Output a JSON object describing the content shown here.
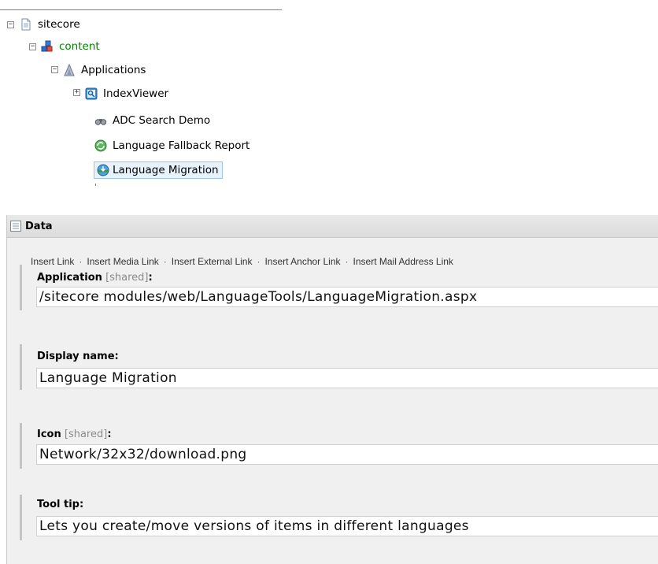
{
  "tree": {
    "root": {
      "label": "sitecore",
      "toggle": "−"
    },
    "content": {
      "label": "content",
      "toggle": "−"
    },
    "applications": {
      "label": "Applications",
      "toggle": "−"
    },
    "indexviewer": {
      "label": "IndexViewer",
      "toggle": "+"
    },
    "adc_search_demo": {
      "label": "ADC Search Demo"
    },
    "language_fallback_report": {
      "label": "Language Fallback Report"
    },
    "language_migration": {
      "label": "Language Migration",
      "selected": true
    }
  },
  "data_section": {
    "title": "Data",
    "toolbar": {
      "insert_link": "Insert Link",
      "insert_media_link": "Insert Media Link",
      "insert_external_link": "Insert External Link",
      "insert_anchor_link": "Insert Anchor Link",
      "insert_mail_address_link": "Insert Mail Address Link",
      "separator": "·"
    },
    "fields": {
      "application": {
        "label": "Application",
        "shared": "[shared]",
        "colon": ":",
        "value": "/sitecore modules/web/LanguageTools/LanguageMigration.aspx"
      },
      "display_name": {
        "label": "Display name:",
        "value": "Language Migration"
      },
      "icon": {
        "label": "Icon",
        "shared": "[shared]",
        "colon": ":",
        "value": "Network/32x32/download.png"
      },
      "tool_tip": {
        "label": "Tool tip:",
        "value": "Lets you create/move versions of items in different languages"
      }
    }
  }
}
